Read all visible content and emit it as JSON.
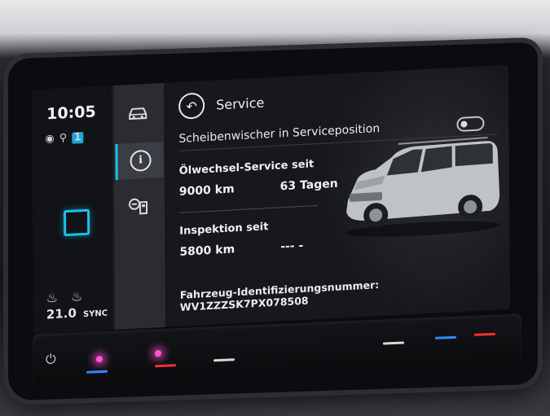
{
  "status": {
    "time": "10:05",
    "indicators": [
      "globe-icon",
      "person-icon"
    ],
    "badge": "1",
    "climate_temp": "21.0",
    "climate_sync": "SYNC"
  },
  "rail": {
    "items": [
      {
        "name": "car-icon"
      },
      {
        "name": "info-icon",
        "glyph": "i",
        "active": true
      },
      {
        "name": "fuel-icon"
      }
    ]
  },
  "header": {
    "title": "Service"
  },
  "settings": {
    "wiper_label": "Scheibenwischer in Serviceposition",
    "wiper_toggle": false
  },
  "oil_service": {
    "label": "Ölwechsel-Service seit",
    "km": "9000 km",
    "days": "63 Tagen"
  },
  "inspection": {
    "label": "Inspektion seit",
    "km": "5800 km",
    "days": "--- -"
  },
  "vin": {
    "text": "Fahrzeug-Identifizierungsnummer: WV1ZZZSK7PX078508"
  },
  "colors": {
    "accent": "#18c3ee",
    "background": "#17181c"
  }
}
